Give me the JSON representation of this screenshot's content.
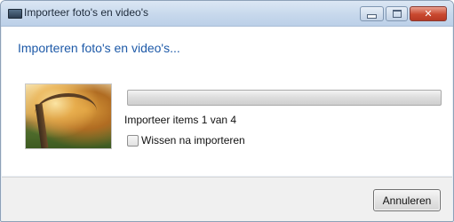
{
  "window": {
    "title": "Importeer foto's en video's",
    "icons": {
      "app": "scanner-camera-icon",
      "minimize": "minimize-icon",
      "maximize": "maximize-icon",
      "close": "close-icon"
    },
    "close_glyph": "✕"
  },
  "main": {
    "heading": "Importeren foto's en video's...",
    "status": "Importeer items 1 van 4",
    "progress": {
      "value": 0,
      "max": 4
    },
    "checkbox": {
      "label": "Wissen na importeren",
      "checked": false
    }
  },
  "footer": {
    "cancel_label": "Annuleren"
  },
  "colors": {
    "heading": "#1e5aa8",
    "titlebar": "#c7d8ec",
    "close": "#c9482f"
  }
}
